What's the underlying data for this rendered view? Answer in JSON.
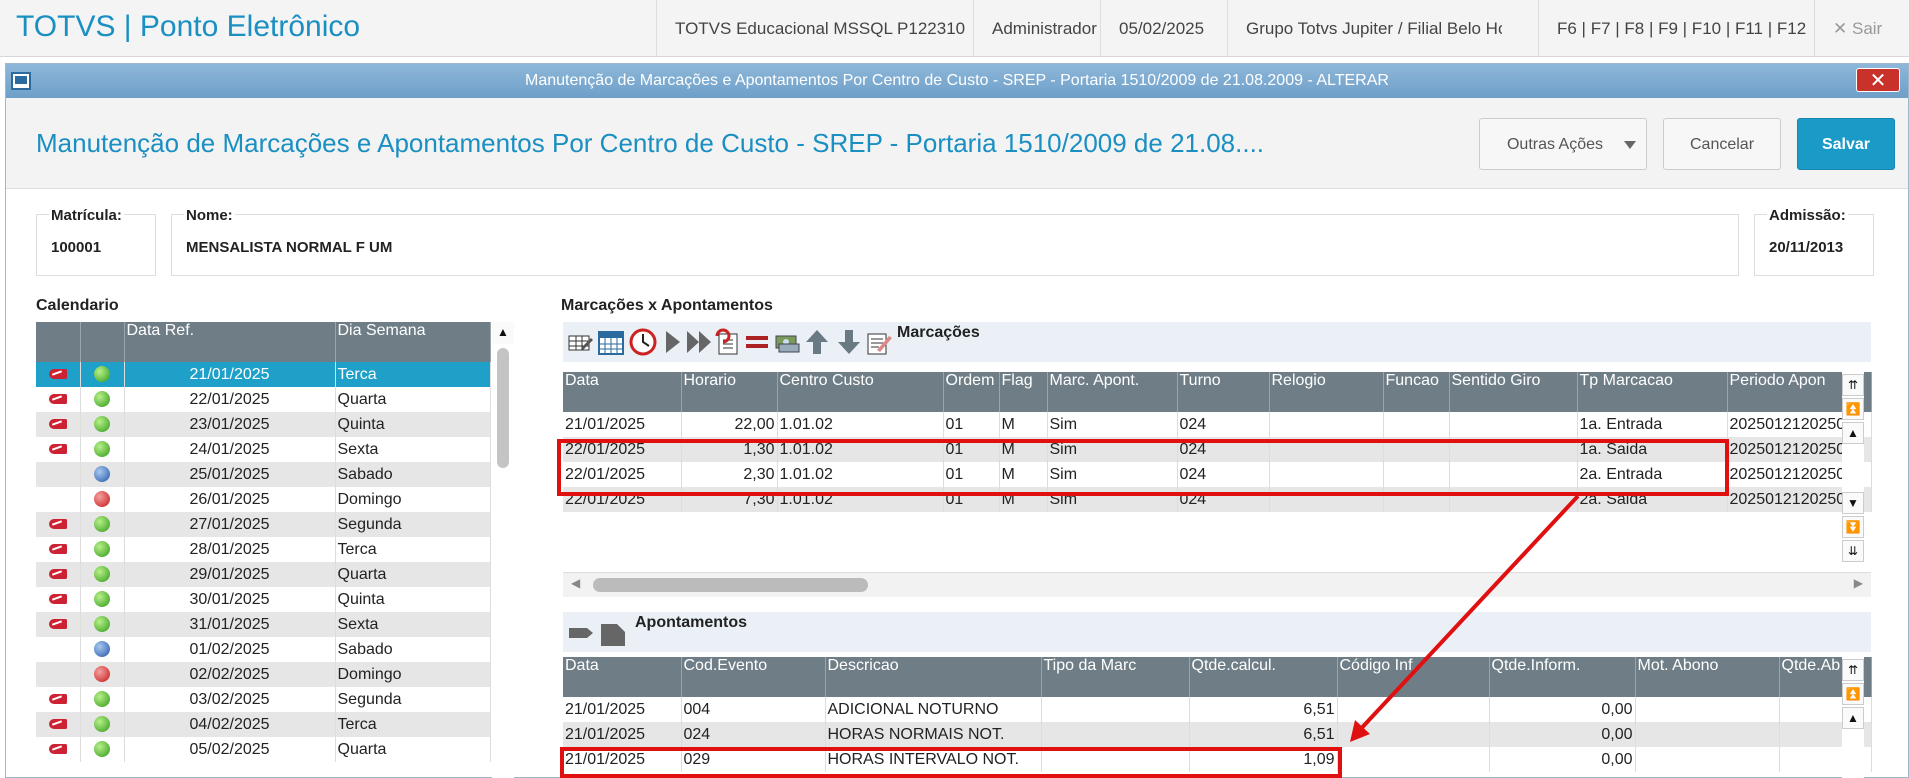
{
  "topbar": {
    "brand": "TOTVS | Ponto Eletrônico",
    "items": [
      "TOTVS Educacional MSSQL P122310",
      "Administrador",
      "05/02/2025",
      "Grupo Totvs Jupiter / Filial Belo Hor",
      "F6 | F7 | F8 | F9 | F10 | F11 | F12"
    ],
    "sair": "Sair"
  },
  "window": {
    "title": "Manutenção de Marcações e Apontamentos Por Centro de Custo - SREP - Portaria 1510/2009 de 21.08.2009 - ALTERAR",
    "header_title": "Manutenção de Marcações e Apontamentos Por Centro de Custo - SREP - Portaria 1510/2009 de 21.08....",
    "close": "✕"
  },
  "actions": {
    "outras": "Outras Ações",
    "cancelar": "Cancelar",
    "salvar": "Salvar"
  },
  "employee": {
    "matricula_label": "Matrícula:",
    "matricula": "100001",
    "nome_label": "Nome:",
    "nome": "MENSALISTA NORMAL F UM",
    "admissao_label": "Admissão:",
    "admissao": "20/11/2013"
  },
  "calendario": {
    "title": "Calendario",
    "columns": [
      "",
      "",
      "Data Ref.",
      "Dia Semana"
    ],
    "rows": [
      {
        "shoe": true,
        "status": "green",
        "date": "21/01/2025",
        "day": "Terca"
      },
      {
        "shoe": true,
        "status": "green",
        "date": "22/01/2025",
        "day": "Quarta"
      },
      {
        "shoe": true,
        "status": "green",
        "date": "23/01/2025",
        "day": "Quinta"
      },
      {
        "shoe": true,
        "status": "green",
        "date": "24/01/2025",
        "day": "Sexta"
      },
      {
        "shoe": false,
        "status": "blue",
        "date": "25/01/2025",
        "day": "Sabado"
      },
      {
        "shoe": false,
        "status": "red",
        "date": "26/01/2025",
        "day": "Domingo"
      },
      {
        "shoe": true,
        "status": "green",
        "date": "27/01/2025",
        "day": "Segunda"
      },
      {
        "shoe": true,
        "status": "green",
        "date": "28/01/2025",
        "day": "Terca"
      },
      {
        "shoe": true,
        "status": "green",
        "date": "29/01/2025",
        "day": "Quarta"
      },
      {
        "shoe": true,
        "status": "green",
        "date": "30/01/2025",
        "day": "Quinta"
      },
      {
        "shoe": true,
        "status": "green",
        "date": "31/01/2025",
        "day": "Sexta"
      },
      {
        "shoe": false,
        "status": "blue",
        "date": "01/02/2025",
        "day": "Sabado"
      },
      {
        "shoe": false,
        "status": "red",
        "date": "02/02/2025",
        "day": "Domingo"
      },
      {
        "shoe": true,
        "status": "green",
        "date": "03/02/2025",
        "day": "Segunda"
      },
      {
        "shoe": true,
        "status": "green",
        "date": "04/02/2025",
        "day": "Terca"
      },
      {
        "shoe": true,
        "status": "green",
        "date": "05/02/2025",
        "day": "Quarta"
      }
    ]
  },
  "marcacoes": {
    "section_title": "Marcações x Apontamentos",
    "toolbar_label": "Marcações",
    "columns": [
      "Data",
      "Horario",
      "Centro Custo",
      "Ordem",
      "Flag",
      "Marc. Apont.",
      "Turno",
      "Relogio",
      "Funcao",
      "Sentido Giro",
      "Tp Marcacao",
      "Periodo Apon"
    ],
    "rows": [
      [
        "21/01/2025",
        "22,00",
        "1.01.02",
        "01",
        "M",
        "Sim",
        "024",
        "",
        "",
        "",
        "1a. Entrada",
        "2025012120250"
      ],
      [
        "22/01/2025",
        "1,30",
        "1.01.02",
        "01",
        "M",
        "Sim",
        "024",
        "",
        "",
        "",
        "1a. Saida",
        "2025012120250"
      ],
      [
        "22/01/2025",
        "2,30",
        "1.01.02",
        "01",
        "M",
        "Sim",
        "024",
        "",
        "",
        "",
        "2a. Entrada",
        "2025012120250"
      ],
      [
        "22/01/2025",
        "7,30",
        "1.01.02",
        "01",
        "M",
        "Sim",
        "024",
        "",
        "",
        "",
        "2a. Saida",
        "2025012120250"
      ]
    ]
  },
  "apontamentos": {
    "toolbar_label": "Apontamentos",
    "columns": [
      "Data",
      "Cod.Evento",
      "Descricao",
      "Tipo da Marc",
      "Qtde.calcul.",
      "Código Inf.",
      "Qtde.Inform.",
      "Mot. Abono",
      "Qtde.Ab"
    ],
    "rows": [
      [
        "21/01/2025",
        "004",
        "ADICIONAL NOTURNO",
        "",
        "6,51",
        "",
        "0,00",
        "",
        ""
      ],
      [
        "21/01/2025",
        "024",
        "HORAS NORMAIS NOT.",
        "",
        "6,51",
        "",
        "0,00",
        "",
        ""
      ],
      [
        "21/01/2025",
        "029",
        "HORAS INTERVALO NOT.",
        "",
        "1,09",
        "",
        "0,00",
        "",
        ""
      ]
    ]
  },
  "colors": {
    "accent": "#1a8fc2",
    "highlight": "#e01010",
    "selected_row": "#1ea0c8"
  }
}
